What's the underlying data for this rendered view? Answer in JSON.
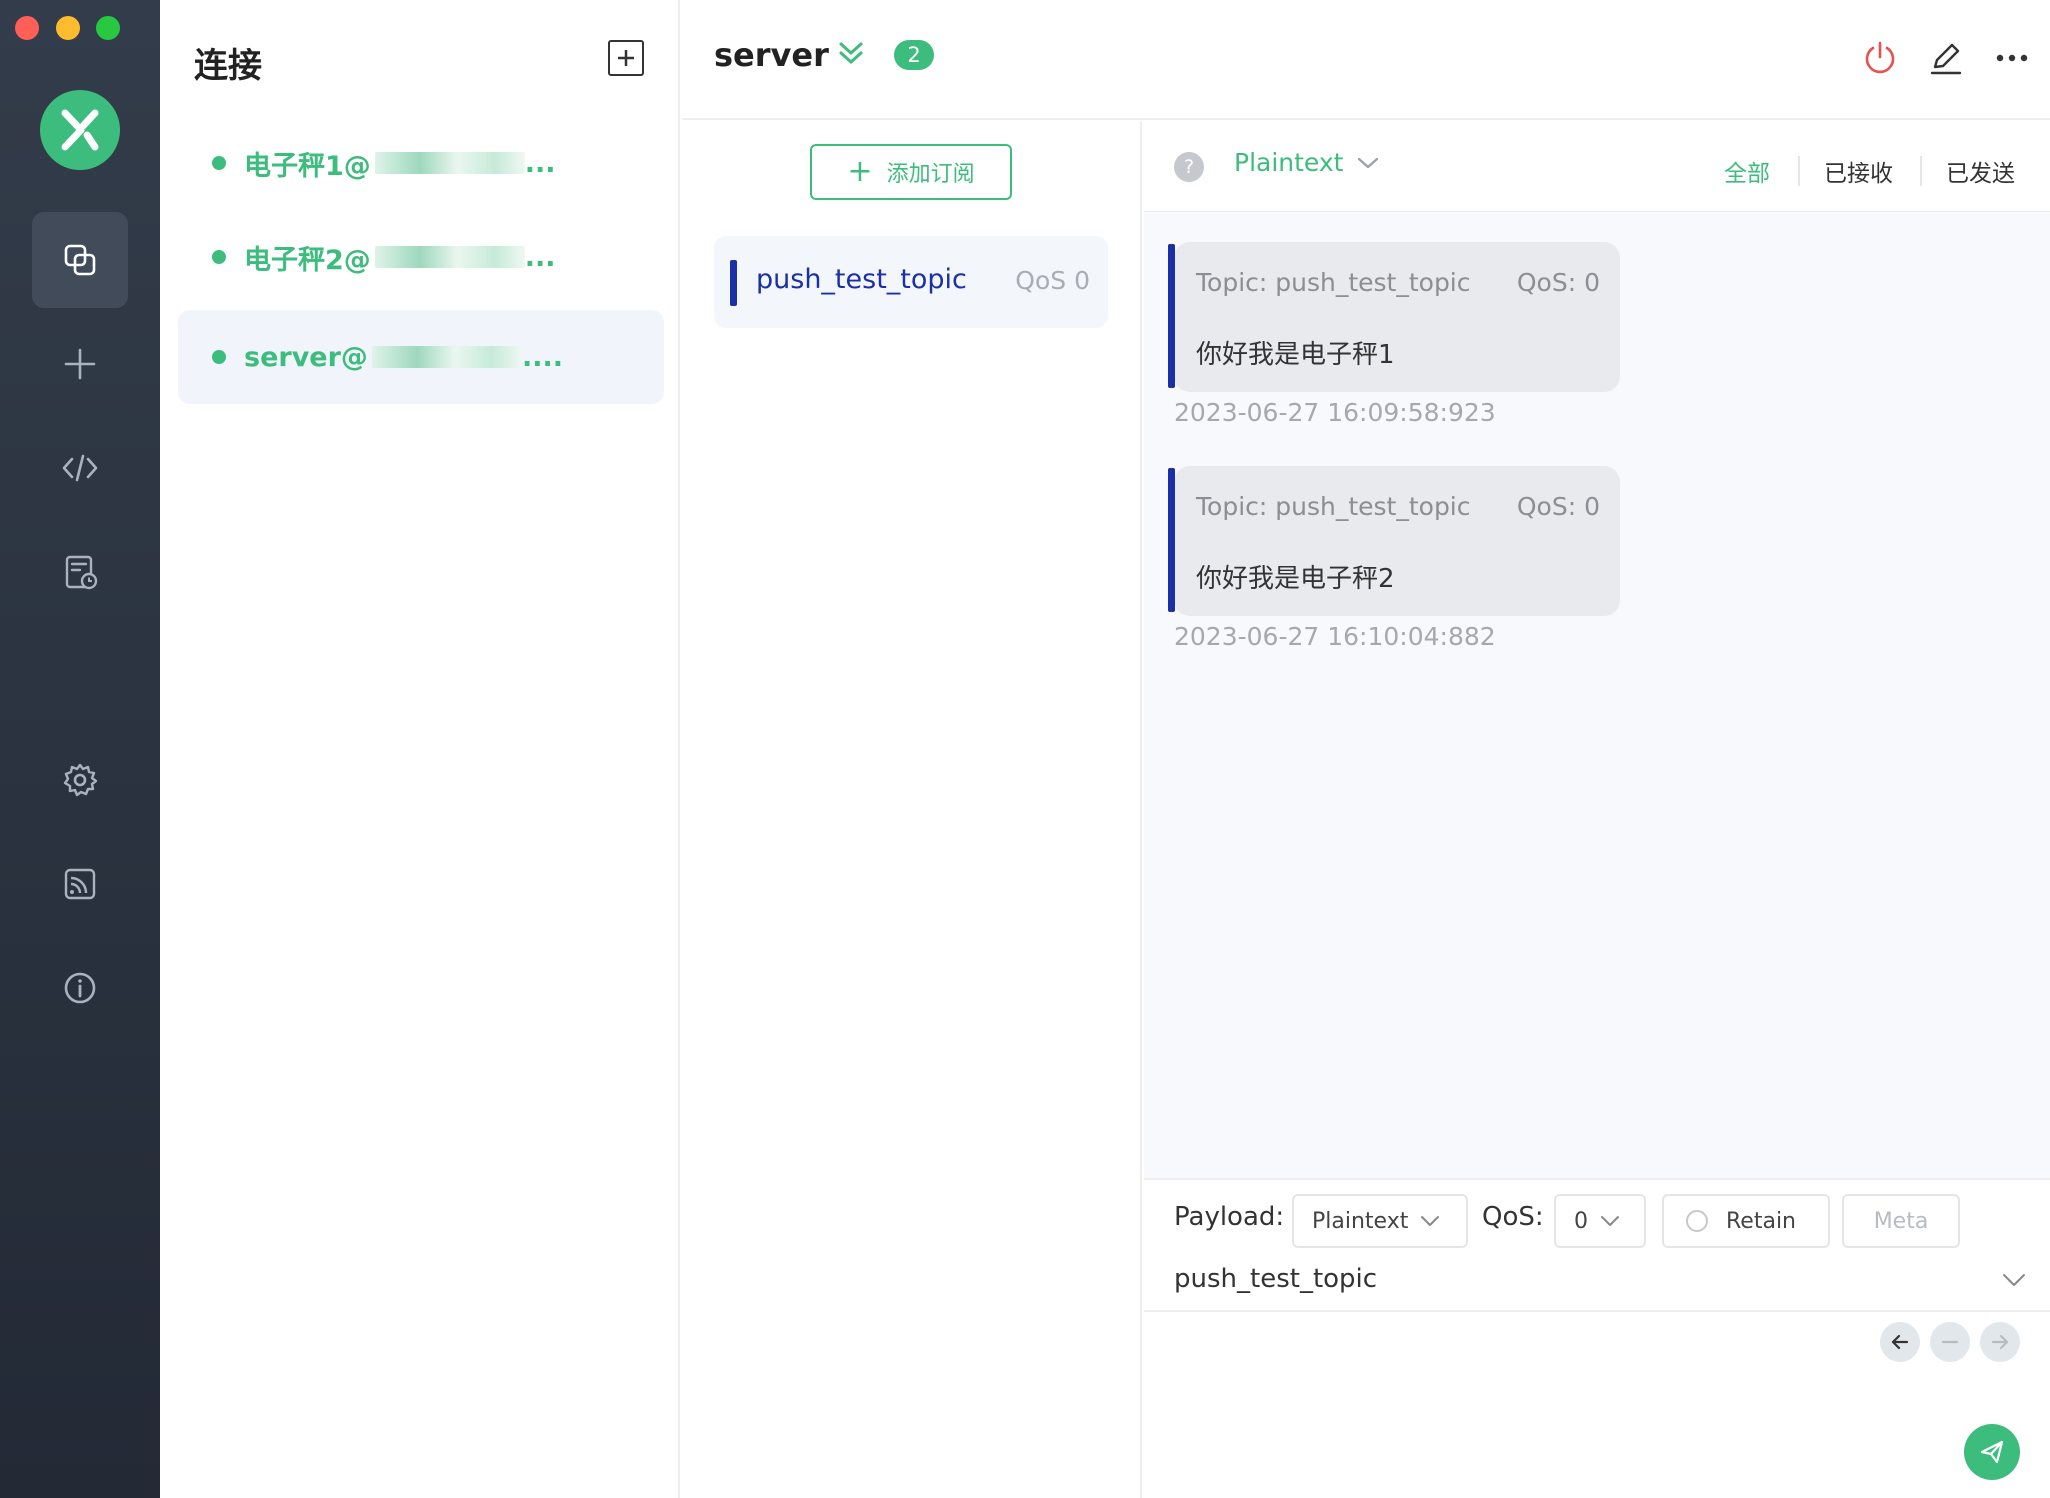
{
  "sidebar": {
    "nav": [
      "connections-icon",
      "plus-icon",
      "code-icon",
      "log-icon",
      "settings-icon",
      "feed-icon",
      "info-icon"
    ]
  },
  "connections": {
    "title": "连接",
    "items": [
      {
        "name": "电子秤1@",
        "suffix": "...",
        "active": false
      },
      {
        "name": "电子秤2@",
        "suffix": "...",
        "active": false
      },
      {
        "name": "server@",
        "suffix": "....",
        "active": true
      }
    ]
  },
  "header": {
    "title": "server",
    "badge": "2"
  },
  "subscriptions": {
    "add_label": "添加订阅",
    "items": [
      {
        "topic": "push_test_topic",
        "qos": "QoS 0",
        "color": "#1b2fa6"
      }
    ]
  },
  "messages": {
    "format": "Plaintext",
    "filters": {
      "all": "全部",
      "received": "已接收",
      "sent": "已发送"
    },
    "list": [
      {
        "topic": "Topic: push_test_topic",
        "qos": "QoS: 0",
        "payload": "你好我是电子秤1",
        "time": "2023-06-27 16:09:58:923"
      },
      {
        "topic": "Topic: push_test_topic",
        "qos": "QoS: 0",
        "payload": "你好我是电子秤2",
        "time": "2023-06-27 16:10:04:882"
      }
    ]
  },
  "publish": {
    "payload_label": "Payload:",
    "payload_format": "Plaintext",
    "qos_label": "QoS:",
    "qos_value": "0",
    "retain_label": "Retain",
    "meta_label": "Meta",
    "topic": "push_test_topic"
  },
  "colors": {
    "accent": "#3dbd7d",
    "topic": "#1b2fa6",
    "rail": "#2b3340",
    "disconnect": "#e8504f"
  }
}
